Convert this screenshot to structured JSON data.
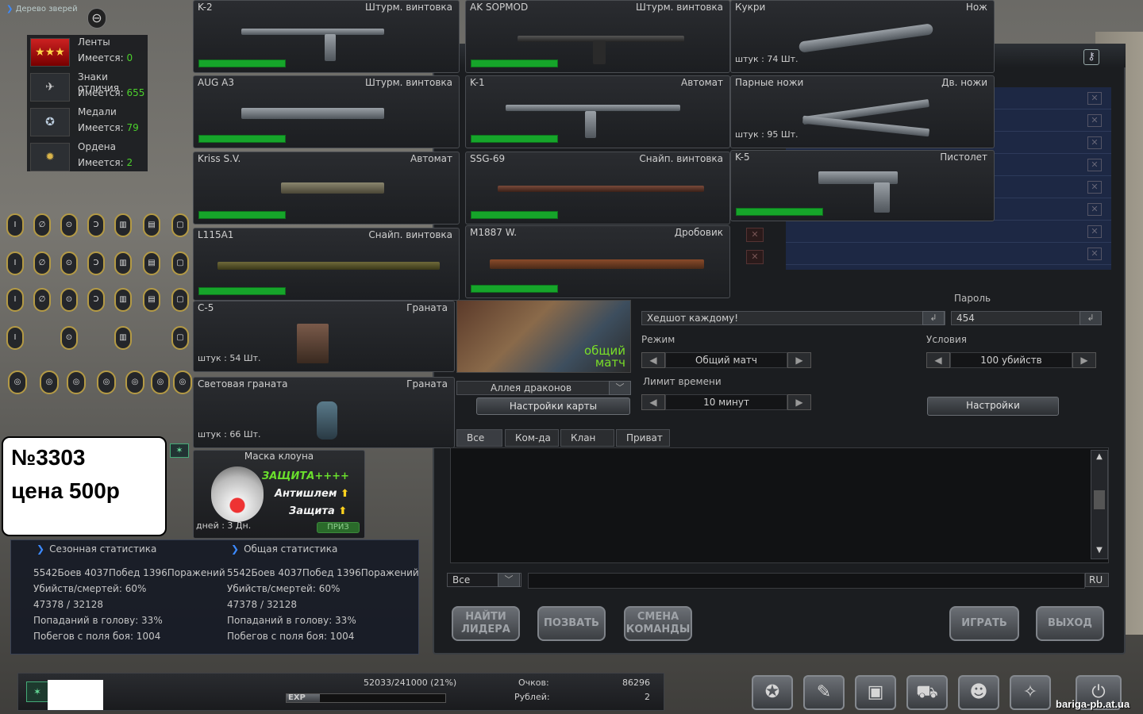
{
  "player": {
    "nick": "Дерево зверей"
  },
  "badges": [
    {
      "name": "Ленты",
      "have_label": "Имеется:",
      "have": "0",
      "icon": "ribbon-icon"
    },
    {
      "name": "Знаки отличия",
      "have_label": "Имеется:",
      "have": "655",
      "icon": "insignia-icon"
    },
    {
      "name": "Медали",
      "have_label": "Имеется:",
      "have": "79",
      "icon": "medal-icon"
    },
    {
      "name": "Ордена",
      "have_label": "Имеется:",
      "have": "2",
      "icon": "order-icon"
    }
  ],
  "weapons": [
    {
      "name": "K-2",
      "type": "Штурм. винтовка"
    },
    {
      "name": "AK SOPMOD",
      "type": "Штурм. винтовка"
    },
    {
      "name": "Кукри",
      "type": "Нож",
      "count": "штук : 74 Шт."
    },
    {
      "name": "AUG A3",
      "type": "Штурм. винтовка"
    },
    {
      "name": "K-1",
      "type": "Автомат"
    },
    {
      "name": "Парные ножи",
      "type": "Дв. ножи",
      "count": "штук : 95 Шт."
    },
    {
      "name": "Kriss S.V.",
      "type": "Автомат"
    },
    {
      "name": "SSG-69",
      "type": "Снайп. винтовка"
    },
    {
      "name": "K-5",
      "type": "Пистолет"
    },
    {
      "name": "L115A1",
      "type": "Снайп. винтовка"
    },
    {
      "name": "M1887 W.",
      "type": "Дробовик"
    },
    {
      "name": "C-5",
      "type": "Граната",
      "count": "штук : 54 Шт."
    },
    {
      "name": "Световая граната",
      "type": "Граната",
      "count": "штук : 66 Шт."
    }
  ],
  "mask": {
    "title": "Маска клоуна",
    "line1": "ЗАЩИТА++++",
    "line2": "Антишлем",
    "line3": "Защита",
    "days": "дней : 3 Дн.",
    "tag": "ПРИЗ"
  },
  "price": {
    "line1": "№3303",
    "line2": "цена 500р"
  },
  "room": {
    "map_mode": "общий матч",
    "map_name": "Аллея драконов",
    "map_settings": "Настройки карты",
    "title_value": "Хедшот каждому!",
    "password_label": "Пароль",
    "password_value": "454",
    "mode_label": "Режим",
    "mode_value": "Общий матч",
    "conditions_label": "Условия",
    "conditions_value": "100 убийств",
    "time_label": "Лимит времени",
    "time_value": "10 минут",
    "settings_button": "Настройки"
  },
  "chat": {
    "tabs": [
      "Все",
      "Ком-да",
      "Клан",
      "Приват"
    ],
    "channel": "Все",
    "lang": "RU"
  },
  "actions": {
    "find_leader": "НАЙТИ ЛИДЕРА",
    "invite": "ПОЗВАТЬ",
    "switch_team": "СМЕНА КОМАНДЫ",
    "play": "ИГРАТЬ",
    "exit": "ВЫХОД"
  },
  "stats": {
    "season_title": "Сезонная статистика",
    "total_title": "Общая статистика",
    "lines": [
      "5542Боев 4037Побед 1396Поражений",
      "Убийств/смертей: 60%",
      "47378 / 32128",
      "Попаданий в голову: 33%",
      "Побегов с поля боя: 1004"
    ]
  },
  "status": {
    "exp": "52033/241000 (21%)",
    "exp_tag": "EXP",
    "points_label": "Очков:",
    "points": "86296",
    "rubles_label": "Рублей:",
    "rubles": "2"
  },
  "watermark": "bariga-pb.at.ua",
  "colors": {
    "accent_green": "#16a52a",
    "have_green": "#4cd22c",
    "mode_green": "#7adf28"
  }
}
